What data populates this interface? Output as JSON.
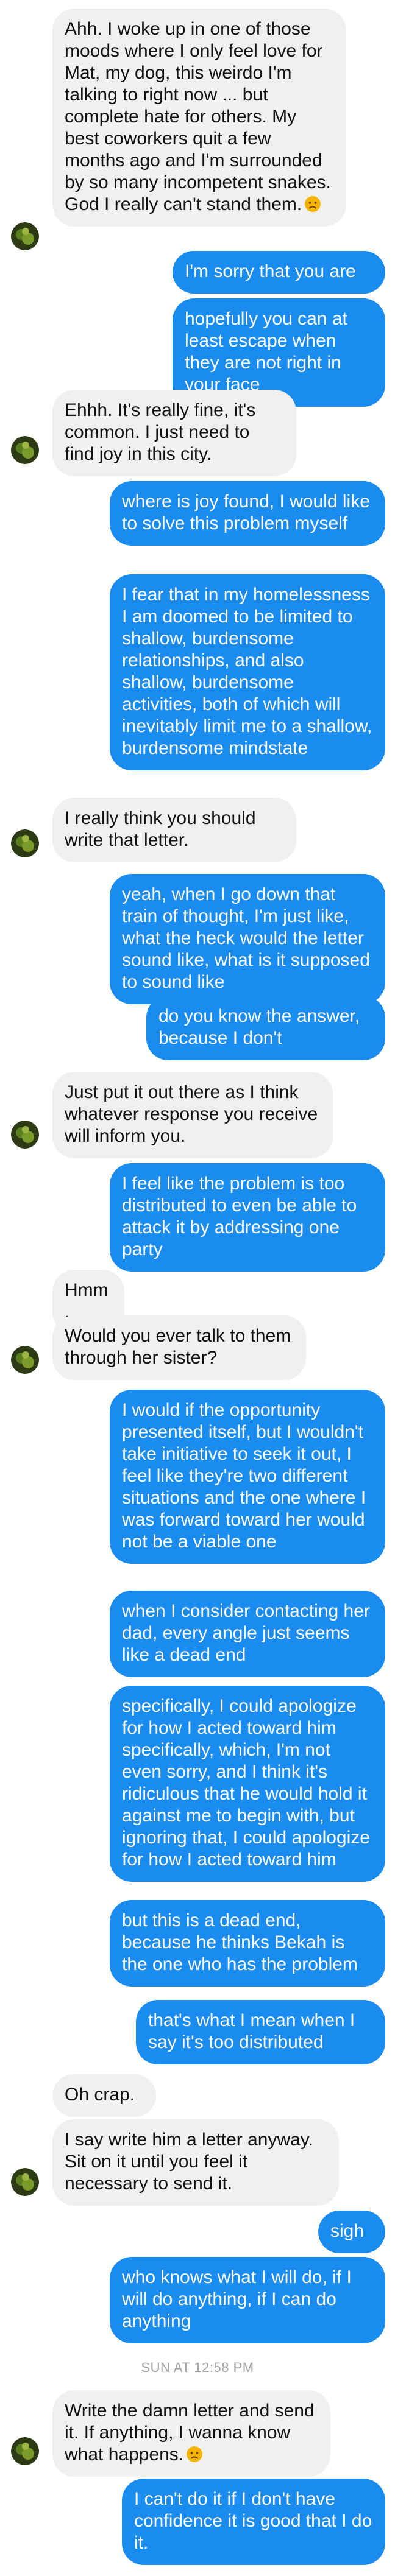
{
  "colors": {
    "incoming_bubble": "#f0f0f0",
    "outgoing_bubble": "#1a8cf0",
    "timestamp": "#a3a3a3"
  },
  "messages": [
    {
      "dir": "in",
      "text": "Ahh. I woke up in one of those moods where I only feel love for Mat, my dog, this weirdo I'm talking to right now ... but complete hate for others. My best coworkers quit a few months ago and I'm surrounded by so many incompetent snakes. God I really can't stand them.",
      "emoji": "disappointed-face-icon"
    },
    {
      "dir": "out",
      "text": "I'm sorry that you are"
    },
    {
      "dir": "out",
      "text": "hopefully you can at least escape when they are not right in your face"
    },
    {
      "dir": "in",
      "text": "Ehhh. It's really fine, it's common. I just need to find joy in this city."
    },
    {
      "dir": "out",
      "text": "where is joy found, I would like to solve this problem myself"
    },
    {
      "dir": "out",
      "text": "I fear that in my homelessness I am doomed to be limited to shallow, burdensome relationships, and also shallow, burdensome activities, both of which will inevitably limit me to a shallow, burdensome mindstate"
    },
    {
      "dir": "in",
      "text": "I really think you should write that letter."
    },
    {
      "dir": "out",
      "text": "yeah, when I go down that train of thought, I'm just like, what the heck would the letter sound like, what is it supposed to sound like"
    },
    {
      "dir": "out",
      "text": "do you know the answer, because I don't"
    },
    {
      "dir": "in",
      "text": "Just put it out there as I think whatever response you receive will inform you."
    },
    {
      "dir": "out",
      "text": "I feel like the problem is too distributed to even be able to attack it by addressing one party"
    },
    {
      "dir": "in",
      "text": "Hmm."
    },
    {
      "dir": "in",
      "text": "Would you ever talk to them through her sister?"
    },
    {
      "dir": "out",
      "text": "I would if the opportunity presented itself, but I wouldn't take initiative to seek it out, I feel like they're two different situations and the one where I was forward toward her would not be a viable one"
    },
    {
      "dir": "out",
      "text": "when I consider contacting her dad, every angle just seems like a dead end"
    },
    {
      "dir": "out",
      "text": "specifically, I could apologize for how I acted toward him specifically, which, I'm not even sorry, and I think it's ridiculous that he would hold it against me to begin with, but ignoring that, I could apologize for how I acted toward him"
    },
    {
      "dir": "out",
      "text": "but this is a dead end, because he thinks Bekah is the one who has the problem"
    },
    {
      "dir": "out",
      "text": "that's what I mean when I say it's too distributed"
    },
    {
      "dir": "in",
      "text": "Oh crap."
    },
    {
      "dir": "in",
      "text": "I say write him a letter anyway. Sit on it until you feel it necessary to send it."
    },
    {
      "dir": "out",
      "text": "sigh"
    },
    {
      "dir": "out",
      "text": "who knows what I will do, if I will do anything, if I can do anything"
    },
    {
      "dir": "in",
      "text": "Write the damn letter and send it. If anything, I wanna know what happens.",
      "emoji": "disappointed-face-icon"
    },
    {
      "dir": "out",
      "text": "I can't do it if I don't have confidence it is good that I do it."
    }
  ],
  "timestamp": "SUN AT 12:58 PM"
}
